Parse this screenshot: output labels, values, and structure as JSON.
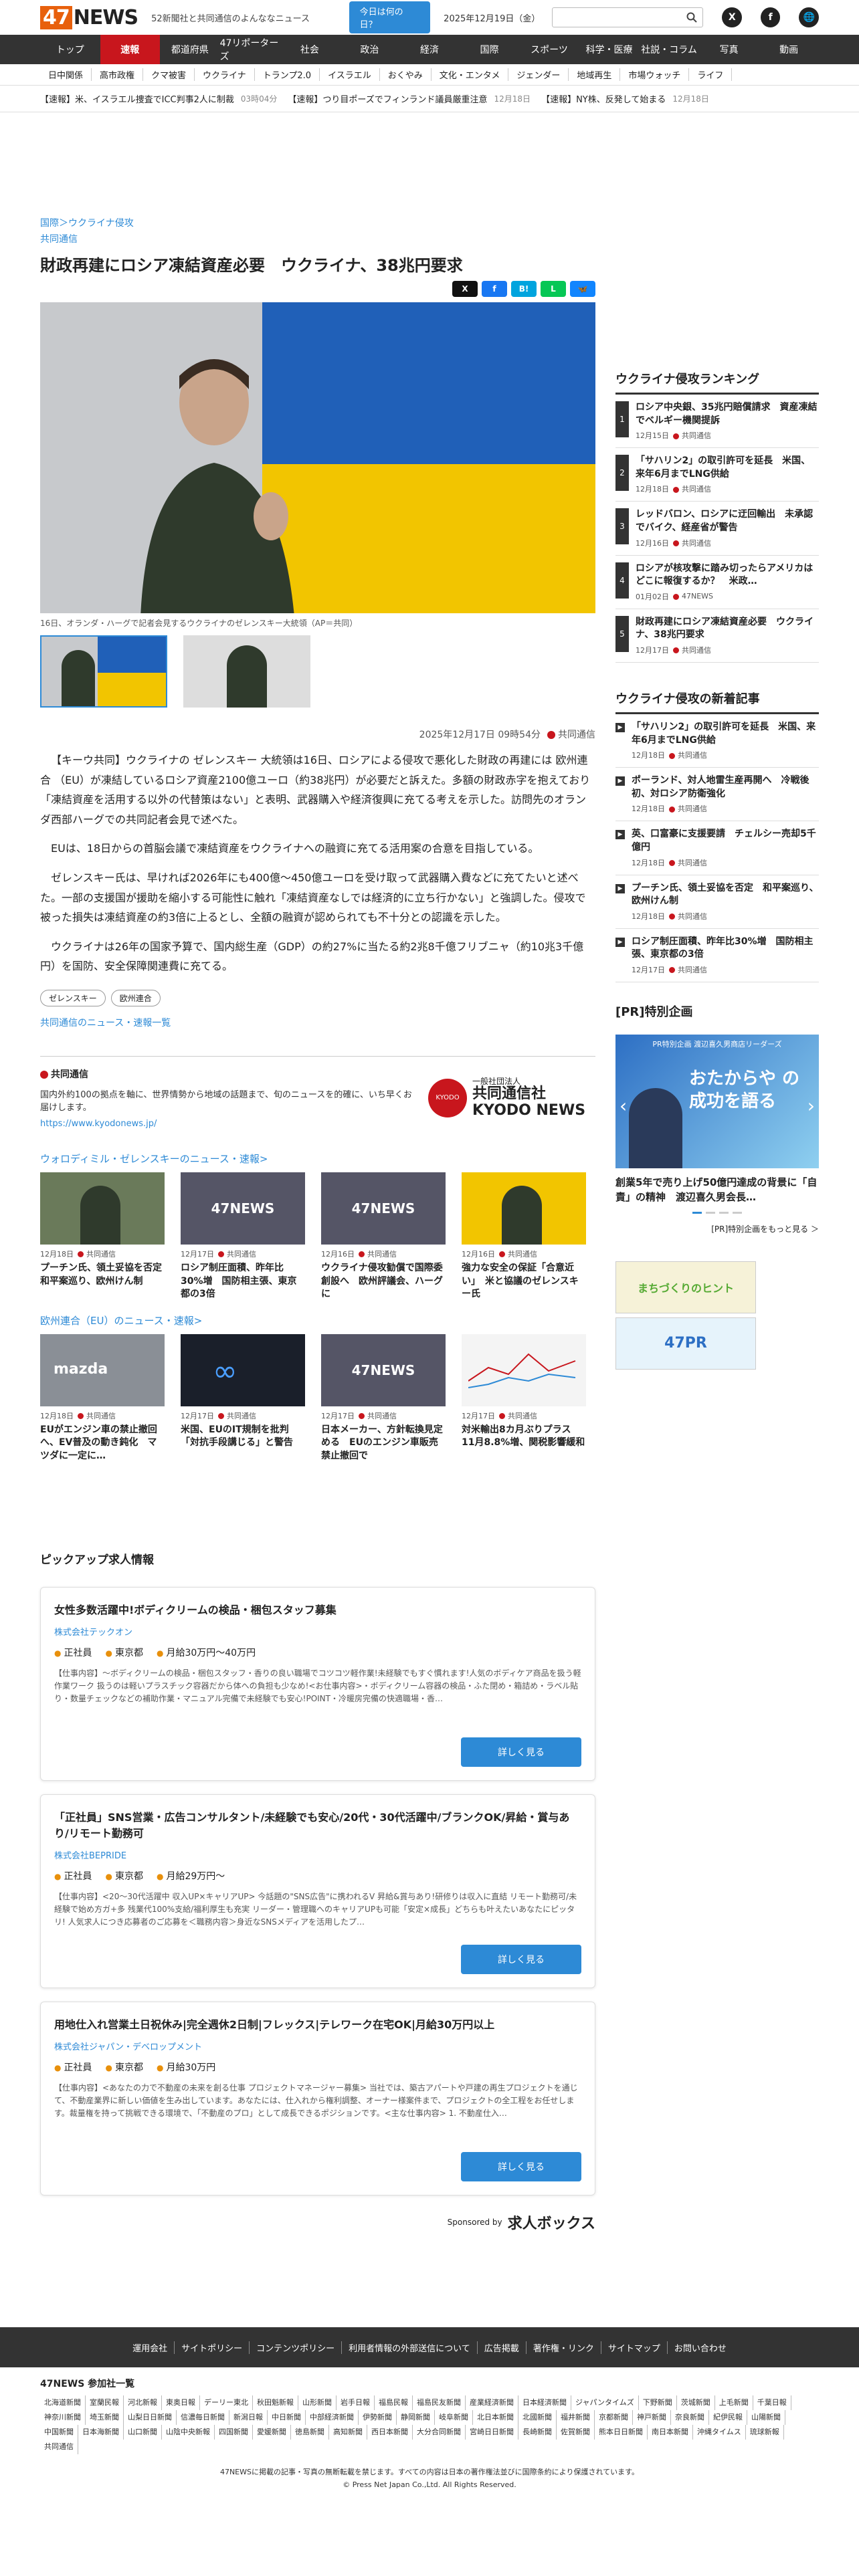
{
  "header": {
    "logo_num": "47",
    "logo_text": "NEWS",
    "tagline": "52新聞社と共同通信のよんななニュース",
    "today_btn": "今日は何の日？",
    "date": "2025年12月19日（金）",
    "social": [
      "X",
      "f",
      "🌐"
    ]
  },
  "nav": [
    "トップ",
    "速報",
    "都道府県",
    "47リポーターズ",
    "社会",
    "政治",
    "経済",
    "国際",
    "スポーツ",
    "科学・医療",
    "社説・コラム",
    "写真",
    "動画"
  ],
  "nav_active": 1,
  "subnav": [
    "日中関係",
    "高市政権",
    "クマ被害",
    "ウクライナ",
    "トランプ2.0",
    "イスラエル",
    "おくやみ",
    "文化・エンタメ",
    "ジェンダー",
    "地域再生",
    "市場ウォッチ",
    "ライフ"
  ],
  "ticker": [
    {
      "text": "【速報】米、イスラエル捜査でICC判事2人に制裁",
      "date": "03時04分"
    },
    {
      "text": "【速報】つり目ポーズでフィンランド議員厳重注意",
      "date": "12月18日"
    },
    {
      "text": "【速報】NY株、反発して始まる",
      "date": "12月18日"
    }
  ],
  "article": {
    "crumb": "国際＞ウクライナ侵攻",
    "source_tag": "共同通信",
    "title": "財政再建にロシア凍結資産必要　ウクライナ、38兆円要求",
    "caption": "16日、オランダ・ハーグで記者会見するウクライナのゼレンスキー大統領（AP＝共同）",
    "datetime": "2025年12月17日 09時54分",
    "source": "共同通信",
    "paragraphs": [
      "【キーウ共同】ウクライナの ゼレンスキー 大統領は16日、ロシアによる侵攻で悪化した財政の再建には 欧州連合 （EU）が凍結しているロシア資産2100億ユーロ（約38兆円）が必要だと訴えた。多額の財政赤字を抱えており「凍結資産を活用する以外の代替策はない」と表明、武器購入や経済復興に充てる考えを示した。訪問先のオランダ西部ハーグでの共同記者会見で述べた。",
      "EUは、18日からの首脳会議で凍結資産をウクライナへの融資に充てる活用案の合意を目指している。",
      "ゼレンスキー氏は、早ければ2026年にも400億～450億ユーロを受け取って武器購入費などに充てたいと述べた。一部の支援国が援助を縮小する可能性に触れ「凍結資産なしでは経済的に立ち行かない」と強調した。侵攻で被った損失は凍結資産の約3倍に上るとし、全額の融資が認められても不十分との認識を示した。",
      "ウクライナは26年の国家予算で、国内総生産（GDP）の約27%に当たる約2兆8千億フリブニャ（約10兆3千億円）を国防、安全保障関連費に充てる。"
    ],
    "tags": [
      "ゼレンスキー",
      "欧州連合"
    ],
    "more_link": "共同通信のニュース・速報一覧"
  },
  "kyodo": {
    "name": "共同通信",
    "desc": "国内外約100の拠点を軸に、世界情勢から地域の話題まで、旬のニュースを的確に、いち早くお届けします。",
    "url": "https://www.kyodonews.jp/",
    "logo_small": "一般社団法人",
    "logo_jp": "共同通信社",
    "logo_en": "KYODO NEWS"
  },
  "related1": {
    "title": "ウォロディミル・ゼレンスキーのニュース・速報>",
    "cards": [
      {
        "date": "12月18日",
        "src": "共同通信",
        "title": "プーチン氏、領土妥協を否定　和平案巡り、欧州けん制"
      },
      {
        "date": "12月17日",
        "src": "共同通信",
        "title": "ロシア制圧面積、昨年比30%増　国防相主張、東京都の3倍"
      },
      {
        "date": "12月16日",
        "src": "共同通信",
        "title": "ウクライナ侵攻勧償で国際委創設へ　欧州評議会、ハーグに"
      },
      {
        "date": "12月16日",
        "src": "共同通信",
        "title": "強力な安全の保証「合意近い」　米と協議のゼレンスキー氏"
      }
    ]
  },
  "related2": {
    "title": "欧州連合（EU）のニュース・速報>",
    "cards": [
      {
        "date": "12月18日",
        "src": "共同通信",
        "title": "EUがエンジン車の禁止撤回へ、EV普及の動き鈍化　マツダに一定に…"
      },
      {
        "date": "12月17日",
        "src": "共同通信",
        "title": "米国、EUのIT規制を批判「対抗手段講じる」と警告"
      },
      {
        "date": "12月17日",
        "src": "共同通信",
        "title": "日本メーカー、方針転換見定める　EUのエンジン車販売禁止撤回で"
      },
      {
        "date": "12月17日",
        "src": "共同通信",
        "title": "対米輸出8カ月ぶりプラス　11月8.8%増、関税影響緩和"
      }
    ]
  },
  "jobs": {
    "heading": "ピックアップ求人情報",
    "button": "詳しく見る",
    "items": [
      {
        "title": "女性多数活躍中!ボディクリームの検品・梱包スタッフ募集",
        "company": "株式会社テックオン",
        "type": "正社員",
        "place": "東京都",
        "salary": "月給30万円〜40万円",
        "desc": "【仕事内容】〜ボディクリームの検品・梱包スタッフ・香りの良い職場でコツコツ軽作業!未経験でもすぐ慣れます!人気のボディケア商品を扱う軽作業ワーク 扱うのは軽いプラスチック容器だから体への負担も少なめ!<お仕事内容>・ボディクリーム容器の検品・ふた閉め・箱詰め・ラベル貼り・数量チェックなどの補助作業・マニュアル完備で未経験でも安心!POINT・冷暖房完備の快適職場・香…"
      },
      {
        "title": "「正社員」SNS営業・広告コンサルタント/未経験でも安心/20代・30代活躍中/ブランクOK/昇給・賞与あり/リモート勤務可",
        "company": "株式会社BEPRIDE",
        "type": "正社員",
        "place": "東京都",
        "salary": "月給29万円〜",
        "desc": "【仕事内容】<20〜30代活躍中 収入UP×キャリアUP> 今話題の\"SNS広告\"に携われるV 昇給&賞与あり!研修りは収入に直結 リモート勤務可/未経験で始め方ガ+多 残業代100%支給/福利厚生も充実 リーダー・管理職へのキャリアUPも可能「安定×成長」どちらも叶えたいあなたにピッタリ! 人気求人につき応募者のご応募を＜職務内容＞身近なSNSメディアを活用したプ…"
      },
      {
        "title": "用地仕入れ営業土日祝休み|完全週休2日制|フレックス|テレワーク在宅OK|月給30万円以上",
        "company": "株式会社ジャパン・デベロップメント",
        "type": "正社員",
        "place": "東京都",
        "salary": "月給30万円",
        "desc": "【仕事内容】<あなたの力で不動産の未来を創る仕事 プロジェクトマネージャー募集> 当社では、築古アパートや戸建の再生プロジェクトを通じて、不動産業界に新しい価値を生み出しています。あなたには、仕入れから権利調整、オーナー様案件まで、プロジェクトの全工程をお任せします。裁量権を持って挑戦できる環境で、「不動産のプロ」として成長できるポジションです。<主な仕事内容> 1. 不動産仕入…"
      }
    ],
    "sponsored_by": "Sponsored by",
    "sponsor_name": "求人ボックス"
  },
  "side": {
    "ranking_title": "ウクライナ侵攻ランキング",
    "ranking": [
      {
        "n": "1",
        "title": "ロシア中央銀、35兆円賠償請求　資産凍結でベルギー機関提訴",
        "date": "12月15日",
        "src": "共同通信"
      },
      {
        "n": "2",
        "title": "「サハリン2」の取引許可を延長　米国、来年6月までLNG供給",
        "date": "12月18日",
        "src": "共同通信"
      },
      {
        "n": "3",
        "title": "レッドバロン、ロシアに迂回輸出　未承認でバイク、経産省が警告",
        "date": "12月16日",
        "src": "共同通信"
      },
      {
        "n": "4",
        "title": "ロシアが核攻撃に踏み切ったらアメリカはどこに報復するか？　米政…",
        "date": "01月02日",
        "src": "47NEWS"
      },
      {
        "n": "5",
        "title": "財政再建にロシア凍結資産必要　ウクライナ、38兆円要求",
        "date": "12月17日",
        "src": "共同通信"
      }
    ],
    "news_title": "ウクライナ侵攻の新着記事",
    "news": [
      {
        "title": "「サハリン2」の取引許可を延長　米国、来年6月までLNG供給",
        "date": "12月18日",
        "src": "共同通信"
      },
      {
        "title": "ポーランド、対人地雷生産再開へ　冷戦後初、対ロシア防衛強化",
        "date": "12月18日",
        "src": "共同通信"
      },
      {
        "title": "英、口富豪に支援要請　チェルシー売却5千億円",
        "date": "12月18日",
        "src": "共同通信"
      },
      {
        "title": "プーチン氏、領土妥協を否定　和平案巡り、欧州けん制",
        "date": "12月18日",
        "src": "共同通信"
      },
      {
        "title": "ロシア制圧面積、昨年比30%増　国防相主張、東京都の3倍",
        "date": "12月17日",
        "src": "共同通信"
      }
    ],
    "pr_title": "[PR]特別企画",
    "pr_banner_top": "PR特別企画 渡辺喜久男商店リーダーズ",
    "pr_banner_main": "おたからや の成功を語る",
    "pr_headline": "創業5年で売り上げ50億円達成の背景に「自責」の精神　渡辺喜久男会長…",
    "pr_list": "[PR]特別企画をもっと見る ＞",
    "ad1": "まちづくりのヒント",
    "ad2": "47PR"
  },
  "footer": {
    "links": [
      "運用会社",
      "サイトポリシー",
      "コンテンツポリシー",
      "利用者情報の外部送信について",
      "広告掲載",
      "著作権・リンク",
      "サイトマップ",
      "お問い合わせ"
    ],
    "part_title": "47NEWS 参加社一覧",
    "papers": [
      "北海道新聞",
      "室蘭民報",
      "河北新報",
      "東奥日報",
      "デーリー東北",
      "秋田魁新報",
      "山形新聞",
      "岩手日報",
      "福島民報",
      "福島民友新聞",
      "産業経済新聞",
      "日本経済新聞",
      "ジャパンタイムズ",
      "下野新聞",
      "茨城新聞",
      "上毛新聞",
      "千葉日報",
      "神奈川新聞",
      "埼玉新聞",
      "山梨日日新聞",
      "信濃毎日新聞",
      "新潟日報",
      "中日新聞",
      "中部経済新聞",
      "伊勢新聞",
      "静岡新聞",
      "岐阜新聞",
      "北日本新聞",
      "北國新聞",
      "福井新聞",
      "京都新聞",
      "神戸新聞",
      "奈良新聞",
      "紀伊民報",
      "山陽新聞",
      "中国新聞",
      "日本海新聞",
      "山口新聞",
      "山陰中央新報",
      "四国新聞",
      "愛媛新聞",
      "徳島新聞",
      "高知新聞",
      "西日本新聞",
      "大分合同新聞",
      "宮崎日日新聞",
      "長崎新聞",
      "佐賀新聞",
      "熊本日日新聞",
      "南日本新聞",
      "沖縄タイムス",
      "琉球新報",
      "共同通信"
    ],
    "copy1": "47NEWSに掲載の記事・写真の無断転載を禁じます。すべての内容は日本の著作権法並びに国際条約により保護されています。",
    "copy2": "© Press Net Japan Co.,Ltd. All Rights Reserved."
  }
}
